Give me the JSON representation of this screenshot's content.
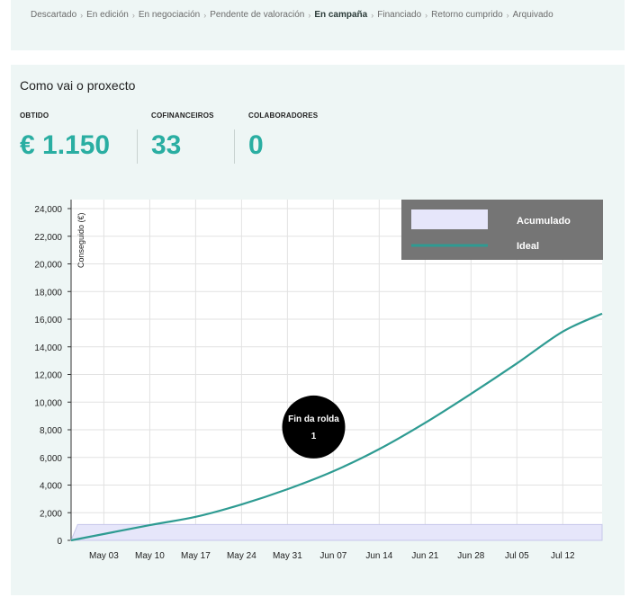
{
  "stages": [
    {
      "label": "Descartado",
      "active": false
    },
    {
      "label": "En edición",
      "active": false
    },
    {
      "label": "En negociación",
      "active": false
    },
    {
      "label": "Pendente de valoración",
      "active": false
    },
    {
      "label": "En campaña",
      "active": true
    },
    {
      "label": "Financiado",
      "active": false
    },
    {
      "label": "Retorno cumprido",
      "active": false
    },
    {
      "label": "Arquivado",
      "active": false
    }
  ],
  "card": {
    "title": "Como vai o proxecto"
  },
  "stats": {
    "obtido": {
      "label": "OBTIDO",
      "value": "€ 1.150"
    },
    "cofinanceiros": {
      "label": "COFINANCEIROS",
      "value": "33"
    },
    "colaboradores": {
      "label": "COLABORADORES",
      "value": "0"
    }
  },
  "colors": {
    "accent": "#2aaea2",
    "ideal_line": "#2e9b92",
    "accumulated_fill": "#e6e6fa",
    "legend_bg": "#757575",
    "marker_bg": "#000000"
  },
  "chart_data": {
    "type": "line",
    "ylabel": "Conseguido (€)",
    "ylim": [
      0,
      24000
    ],
    "y_ticks": [
      "0",
      "2,000",
      "4,000",
      "6,000",
      "8,000",
      "10,000",
      "12,000",
      "14,000",
      "16,000",
      "18,000",
      "20,000",
      "22,000",
      "24,000"
    ],
    "x_ticks": [
      "May 03",
      "May 10",
      "May 17",
      "May 24",
      "May 31",
      "Jun 07",
      "Jun 14",
      "Jun 21",
      "Jun 28",
      "Jul 05",
      "Jul 12"
    ],
    "x_start": "2021-04-28",
    "x_end": "2021-07-18",
    "legend_position": "top-right",
    "grid": true,
    "series": [
      {
        "name": "Acumulado",
        "style": "area",
        "points": [
          {
            "date": "2021-04-28",
            "value": 0
          },
          {
            "date": "2021-04-29",
            "value": 1150
          },
          {
            "date": "2021-07-18",
            "value": 1150
          }
        ]
      },
      {
        "name": "Ideal",
        "style": "line",
        "points": [
          {
            "date": "2021-04-28",
            "value": 0
          },
          {
            "date": "2021-05-10",
            "value": 1100
          },
          {
            "date": "2021-05-17",
            "value": 1700
          },
          {
            "date": "2021-05-24",
            "value": 2600
          },
          {
            "date": "2021-05-31",
            "value": 3700
          },
          {
            "date": "2021-06-07",
            "value": 5000
          },
          {
            "date": "2021-06-14",
            "value": 6600
          },
          {
            "date": "2021-06-21",
            "value": 8500
          },
          {
            "date": "2021-06-28",
            "value": 10600
          },
          {
            "date": "2021-07-05",
            "value": 12800
          },
          {
            "date": "2021-07-12",
            "value": 15100
          },
          {
            "date": "2021-07-18",
            "value": 16400
          }
        ]
      }
    ],
    "annotations": [
      {
        "line1": "Fin da rolda",
        "line2": "1",
        "date": "2021-06-04",
        "value": 8200
      }
    ]
  }
}
